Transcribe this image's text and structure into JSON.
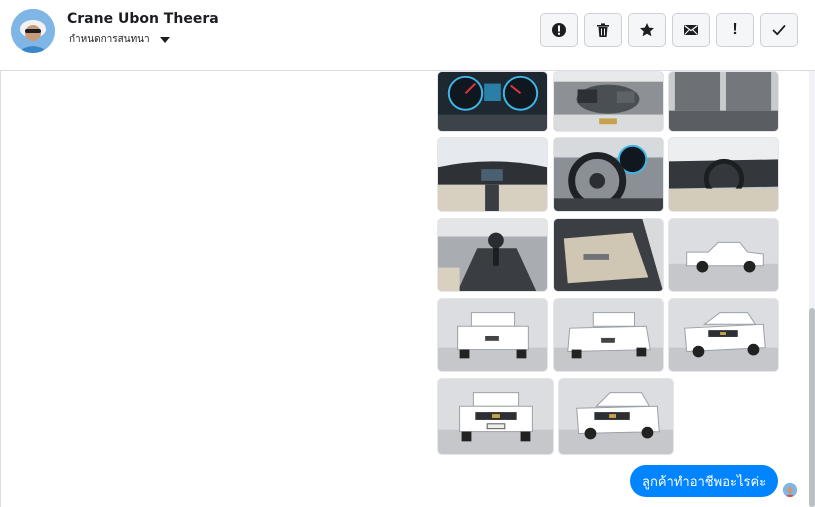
{
  "header": {
    "contact_name": "Crane Ubon Theera",
    "settings_label": "กำหนดการสนทนา",
    "avatar_icon": "profile-photo"
  },
  "toolbar": {
    "buttons": [
      {
        "name": "report-spam-button",
        "icon": "exclamation-circle-icon"
      },
      {
        "name": "delete-button",
        "icon": "trash-icon"
      },
      {
        "name": "star-button",
        "icon": "star-icon"
      },
      {
        "name": "mark-unread-button",
        "icon": "envelope-icon"
      },
      {
        "name": "follow-up-button",
        "icon": "exclamation-icon",
        "glyph": "!"
      },
      {
        "name": "mark-done-button",
        "icon": "check-icon"
      }
    ]
  },
  "gallery": {
    "photos": [
      {
        "subject": "dashboard gauges"
      },
      {
        "subject": "engine bay"
      },
      {
        "subject": "rear seats"
      },
      {
        "subject": "cabin dashboard"
      },
      {
        "subject": "steering wheel and gauges"
      },
      {
        "subject": "driver side interior"
      },
      {
        "subject": "gear shifter"
      },
      {
        "subject": "door panel"
      },
      {
        "subject": "pickup side view"
      },
      {
        "subject": "pickup rear view"
      },
      {
        "subject": "pickup rear three-quarter view"
      },
      {
        "subject": "pickup front three-quarter view"
      },
      {
        "subject": "pickup front view"
      },
      {
        "subject": "pickup front angle view"
      }
    ]
  },
  "message": {
    "text": "ลูกค้าทำอาชีพอะไรค่ะ",
    "accent": "#0084ff"
  }
}
